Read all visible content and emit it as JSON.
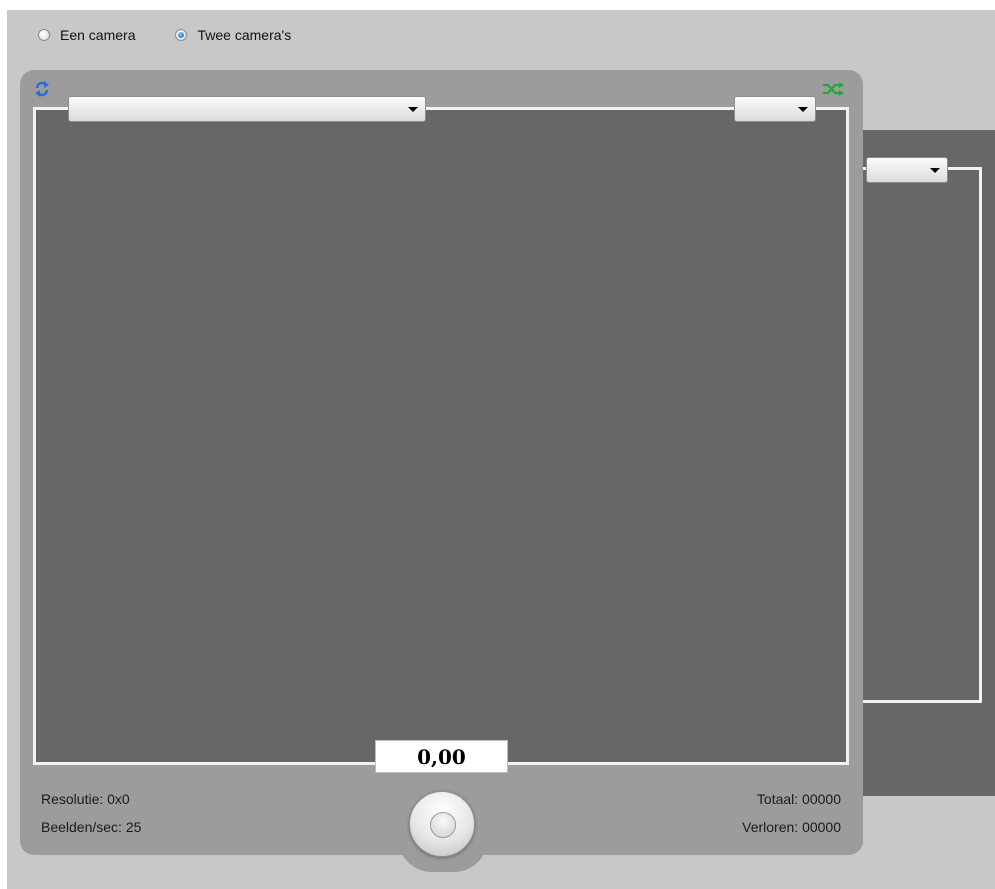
{
  "mode": {
    "options": [
      {
        "label": "Een camera",
        "checked": false
      },
      {
        "label": "Twee camera's",
        "checked": true
      }
    ]
  },
  "camera1": {
    "source_value": "",
    "resolution_value": "",
    "timer": "0,00",
    "info": {
      "resolution": "Resolutie: 0x0",
      "fps": "Beelden/sec: 25",
      "total": "Totaal: 00000",
      "lost": "Verloren: 00000"
    },
    "icons": {
      "refresh": "refresh-icon",
      "switch": "switch-cameras-icon",
      "capture": "capture-button-icon"
    }
  },
  "camera2": {
    "resolution_value": ""
  },
  "colors": {
    "app_background": "#c8c8c8",
    "panel": "#9c9c9c",
    "video": "#676767",
    "frame": "#f2f2f2",
    "refresh_icon": "#2a6fd8",
    "switch_icon": "#22a834"
  }
}
